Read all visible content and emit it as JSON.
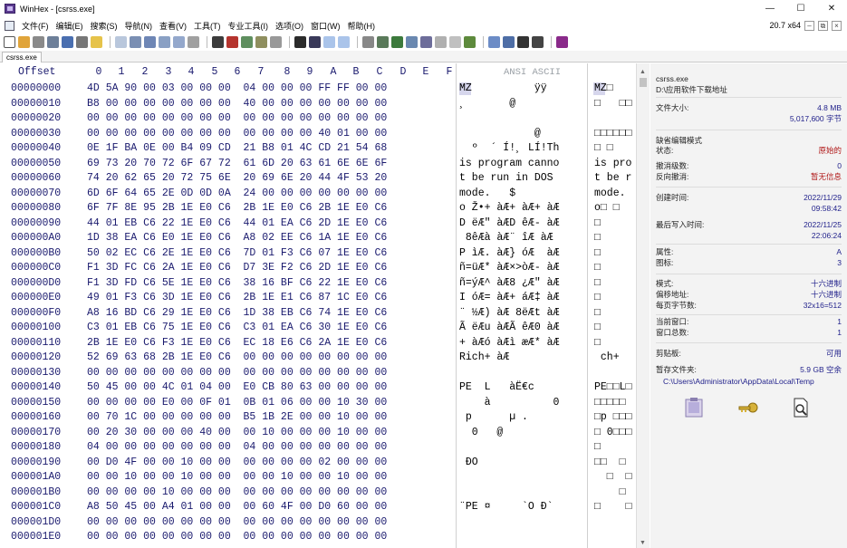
{
  "window": {
    "title": "WinHex - [csrss.exe]",
    "controls": [
      "—",
      "☐",
      "✕"
    ]
  },
  "menu": {
    "items": [
      "文件(F)",
      "编辑(E)",
      "搜索(S)",
      "导航(N)",
      "查看(V)",
      "工具(T)",
      "专业工具(I)",
      "选项(O)",
      "窗口(W)",
      "帮助(H)"
    ],
    "version": "20.7 x64",
    "mini_buttons": [
      "–",
      "⧉",
      "×"
    ]
  },
  "tab": {
    "label": "csrss.exe"
  },
  "hex_view": {
    "offset_header": "Offset",
    "column_headers": [
      "0",
      "1",
      "2",
      "3",
      "4",
      "5",
      "6",
      "7",
      "8",
      "9",
      "A",
      "B",
      "C",
      "D",
      "E",
      "F"
    ],
    "ansi_header": "ANSI ASCII",
    "rows": [
      {
        "offset": "00000000",
        "hex": "4D 5A 90 00 03 00 00 00  04 00 00 00 FF FF 00 00",
        "ansi": "MZ          ÿÿ",
        "ansi2": "MZ□"
      },
      {
        "offset": "00000010",
        "hex": "B8 00 00 00 00 00 00 00  40 00 00 00 00 00 00 00",
        "ansi": "¸       @",
        "ansi2": "□   □□"
      },
      {
        "offset": "00000020",
        "hex": "00 00 00 00 00 00 00 00  00 00 00 00 00 00 00 00",
        "ansi": "",
        "ansi2": ""
      },
      {
        "offset": "00000030",
        "hex": "00 00 00 00 00 00 00 00  00 00 00 00 40 01 00 00",
        "ansi": "            @",
        "ansi2": "□□□□□□"
      },
      {
        "offset": "00000040",
        "hex": "0E 1F BA 0E 00 B4 09 CD  21 B8 01 4C CD 21 54 68",
        "ansi": "  º  ´ Í!¸ LÍ!Th",
        "ansi2": "□ □"
      },
      {
        "offset": "00000050",
        "hex": "69 73 20 70 72 6F 67 72  61 6D 20 63 61 6E 6E 6F",
        "ansi": "is program canno",
        "ansi2": "is pro"
      },
      {
        "offset": "00000060",
        "hex": "74 20 62 65 20 72 75 6E  20 69 6E 20 44 4F 53 20",
        "ansi": "t be run in DOS",
        "ansi2": "t be r"
      },
      {
        "offset": "00000070",
        "hex": "6D 6F 64 65 2E 0D 0D 0A  24 00 00 00 00 00 00 00",
        "ansi": "mode.   $",
        "ansi2": "mode."
      },
      {
        "offset": "00000080",
        "hex": "6F 7F 8E 95 2B 1E E0 C6  2B 1E E0 C6 2B 1E E0 C6",
        "ansi": "o Ž•+ àÆ+ àÆ+ àÆ",
        "ansi2": "o□ □"
      },
      {
        "offset": "00000090",
        "hex": "44 01 EB C6 22 1E E0 C6  44 01 EA C6 2D 1E E0 C6",
        "ansi": "D ëÆ\" àÆD êÆ- àÆ",
        "ansi2": "□"
      },
      {
        "offset": "000000A0",
        "hex": "1D 38 EA C6 E0 1E E0 C6  A8 02 EE C6 1A 1E E0 C6",
        "ansi": " 8êÆà àÆ¨ îÆ àÆ",
        "ansi2": "□"
      },
      {
        "offset": "000000B0",
        "hex": "50 02 EC C6 2E 1E E0 C6  7D 01 F3 C6 07 1E E0 C6",
        "ansi": "P ìÆ. àÆ} óÆ  àÆ",
        "ansi2": "□"
      },
      {
        "offset": "000000C0",
        "hex": "F1 3D FC C6 2A 1E E0 C6  D7 3E F2 C6 2D 1E E0 C6",
        "ansi": "ñ=üÆ* àÆ×>òÆ- àÆ",
        "ansi2": "□"
      },
      {
        "offset": "000000D0",
        "hex": "F1 3D FD C6 5E 1E E0 C6  38 16 BF C6 22 1E E0 C6",
        "ansi": "ñ=ýÆ^ àÆ8 ¿Æ\" àÆ",
        "ansi2": "□"
      },
      {
        "offset": "000000E0",
        "hex": "49 01 F3 C6 3D 1E E0 C6  2B 1E E1 C6 87 1C E0 C6",
        "ansi": "I óÆ= àÆ+ áÆ‡ àÆ",
        "ansi2": "□"
      },
      {
        "offset": "000000F0",
        "hex": "A8 16 BD C6 29 1E E0 C6  1D 38 EB C6 74 1E E0 C6",
        "ansi": "¨ ½Æ) àÆ 8ëÆt àÆ",
        "ansi2": "□"
      },
      {
        "offset": "00000100",
        "hex": "C3 01 EB C6 75 1E E0 C6  C3 01 EA C6 30 1E E0 C6",
        "ansi": "Ã ëÆu àÆÃ êÆ0 àÆ",
        "ansi2": "□"
      },
      {
        "offset": "00000110",
        "hex": "2B 1E E0 C6 F3 1E E0 C6  EC 18 E6 C6 2A 1E E0 C6",
        "ansi": "+ àÆó àÆì æÆ* àÆ",
        "ansi2": "□"
      },
      {
        "offset": "00000120",
        "hex": "52 69 63 68 2B 1E E0 C6  00 00 00 00 00 00 00 00",
        "ansi": "Rich+ àÆ",
        "ansi2": " ch+"
      },
      {
        "offset": "00000130",
        "hex": "00 00 00 00 00 00 00 00  00 00 00 00 00 00 00 00",
        "ansi": "",
        "ansi2": ""
      },
      {
        "offset": "00000140",
        "hex": "50 45 00 00 4C 01 04 00  E0 CB 80 63 00 00 00 00",
        "ansi": "PE  L   àË€c",
        "ansi2": "PE□□L□"
      },
      {
        "offset": "00000150",
        "hex": "00 00 00 00 E0 00 0F 01  0B 01 06 00 00 10 30 00",
        "ansi": "    à          0",
        "ansi2": "□□□□□"
      },
      {
        "offset": "00000160",
        "hex": "00 70 1C 00 00 00 00 00  B5 1B 2E 00 00 10 00 00",
        "ansi": " p      µ .",
        "ansi2": "□p □□□"
      },
      {
        "offset": "00000170",
        "hex": "00 20 30 00 00 00 40 00  00 10 00 00 00 10 00 00",
        "ansi": "  0   @",
        "ansi2": "□ 0□□□"
      },
      {
        "offset": "00000180",
        "hex": "04 00 00 00 00 00 00 00  04 00 00 00 00 00 00 00",
        "ansi": "",
        "ansi2": "□"
      },
      {
        "offset": "00000190",
        "hex": "00 D0 4F 00 00 10 00 00  00 00 00 00 02 00 00 00",
        "ansi": " ÐO",
        "ansi2": "□□  □"
      },
      {
        "offset": "000001A0",
        "hex": "00 00 10 00 00 10 00 00  00 00 10 00 00 10 00 00",
        "ansi": "",
        "ansi2": "  □  □"
      },
      {
        "offset": "000001B0",
        "hex": "00 00 00 00 10 00 00 00  00 00 00 00 00 00 00 00",
        "ansi": "",
        "ansi2": "    □"
      },
      {
        "offset": "000001C0",
        "hex": "A8 50 45 00 A4 01 00 00  00 60 4F 00 D0 60 00 00",
        "ansi": "¨PE ¤     `O Ð`",
        "ansi2": "□    □"
      },
      {
        "offset": "000001D0",
        "hex": "00 00 00 00 00 00 00 00  00 00 00 00 00 00 00 00",
        "ansi": "",
        "ansi2": ""
      },
      {
        "offset": "000001E0",
        "hex": "00 00 00 00 00 00 00 00  00 00 00 00 00 00 00 00",
        "ansi": "",
        "ansi2": ""
      }
    ]
  },
  "side_panel": {
    "file_name": "csrss.exe",
    "file_path": "D:\\应用软件下载地址",
    "file_size_label": "文件大小:",
    "file_size_mb": "4.8 MB",
    "file_size_bytes": "5,017,600 字节",
    "edit_mode_label": "缺省编辑模式",
    "state_label": "状态:",
    "state_value": "原始的",
    "undo_level_label": "撤消级数:",
    "undo_level_value": "0",
    "reverse_undo_label": "反向撤消:",
    "reverse_undo_value": "暂无信息",
    "created_label": "创建时间:",
    "created_date": "2022/11/29",
    "created_time": "09:58:42",
    "modified_label": "最后写入时间:",
    "modified_date": "2022/11/25",
    "modified_time": "22:06:24",
    "attr_label": "属性:",
    "attr_value": "A",
    "icon_label": "图标:",
    "icon_value": "3",
    "mode_label": "模式:",
    "mode_value": "十六进制",
    "offset_label": "偏移地址:",
    "offset_value": "十六进制",
    "bytes_per_page_label": "每页字节数:",
    "bytes_per_page_value": "32x16=512",
    "current_window_label": "当前窗口:",
    "current_window_value": "1",
    "window_total_label": "窗口总数:",
    "window_total_value": "1",
    "clipboard_label": "剪贴板:",
    "clipboard_value": "可用",
    "temp_folder_label": "暂存文件夹:",
    "temp_folder_value": "5.9 GB 空余",
    "temp_folder_path": "C:\\Users\\Administrator\\AppData\\Local\\Temp"
  },
  "colors": {
    "hex_text": "#1a1a6e",
    "panel_value": "#1f1f8a",
    "panel_bg": "#f3f3f3"
  }
}
